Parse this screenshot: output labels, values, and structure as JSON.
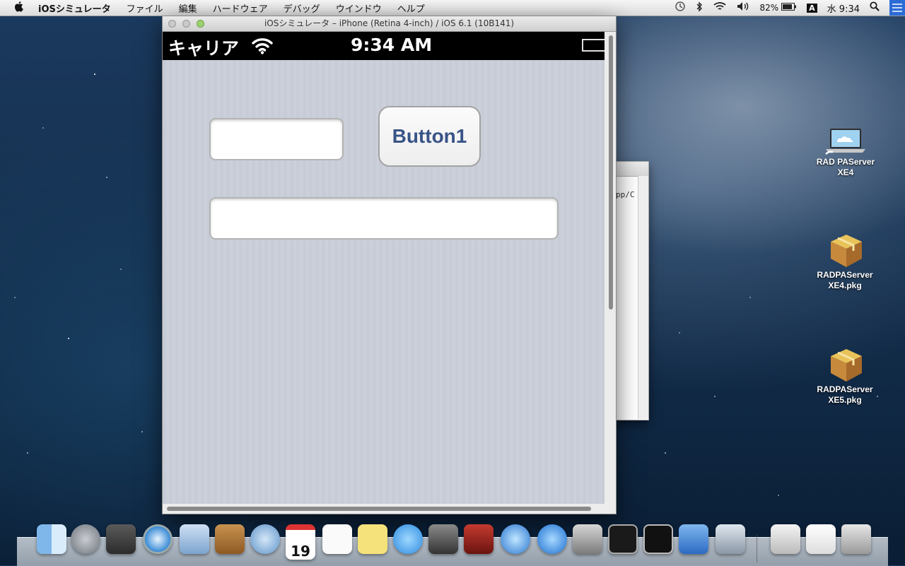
{
  "menubar": {
    "app_name": "iOSシミュレータ",
    "menus": [
      "ファイル",
      "編集",
      "ハードウェア",
      "デバッグ",
      "ウインドウ",
      "ヘルプ"
    ],
    "battery": "82%",
    "input_method": "A",
    "clock": "水 9:34"
  },
  "simulator": {
    "title": "iOSシミュレータ – iPhone (Retina 4-inch) / iOS 6.1 (10B141)",
    "status_bar": {
      "carrier": "キャリア",
      "time": "9:34 AM"
    },
    "form": {
      "edit1_value": "",
      "edit2_value": "",
      "button_label": "Button1"
    }
  },
  "background_window": {
    "text": "pp/C"
  },
  "desktop_icons": [
    {
      "label_line1": "RAD PAServer",
      "label_line2": "XE4",
      "icon": "laptop-alias-icon"
    },
    {
      "label_line1": "RADPAServer",
      "label_line2": "XE4.pkg",
      "icon": "package-icon"
    },
    {
      "label_line1": "RADPAServer",
      "label_line2": "XE5.pkg",
      "icon": "package-icon"
    }
  ],
  "dock": {
    "apps": [
      "Finder",
      "Launchpad",
      "Mission Control",
      "Safari",
      "Mail",
      "Contacts",
      "Notes Utility",
      "Calendar",
      "Reminders",
      "Stickies",
      "Messages",
      "FaceTime",
      "Photo Booth",
      "iTunes",
      "App Store",
      "System Preferences",
      "Activity Monitor",
      "Terminal",
      "Xcode",
      "iOS Simulator"
    ],
    "calendar_day": "19"
  },
  "colors": {
    "button_text": "#385487",
    "status_bar_bg": "#000000",
    "content_bg": "#c9ced8"
  }
}
